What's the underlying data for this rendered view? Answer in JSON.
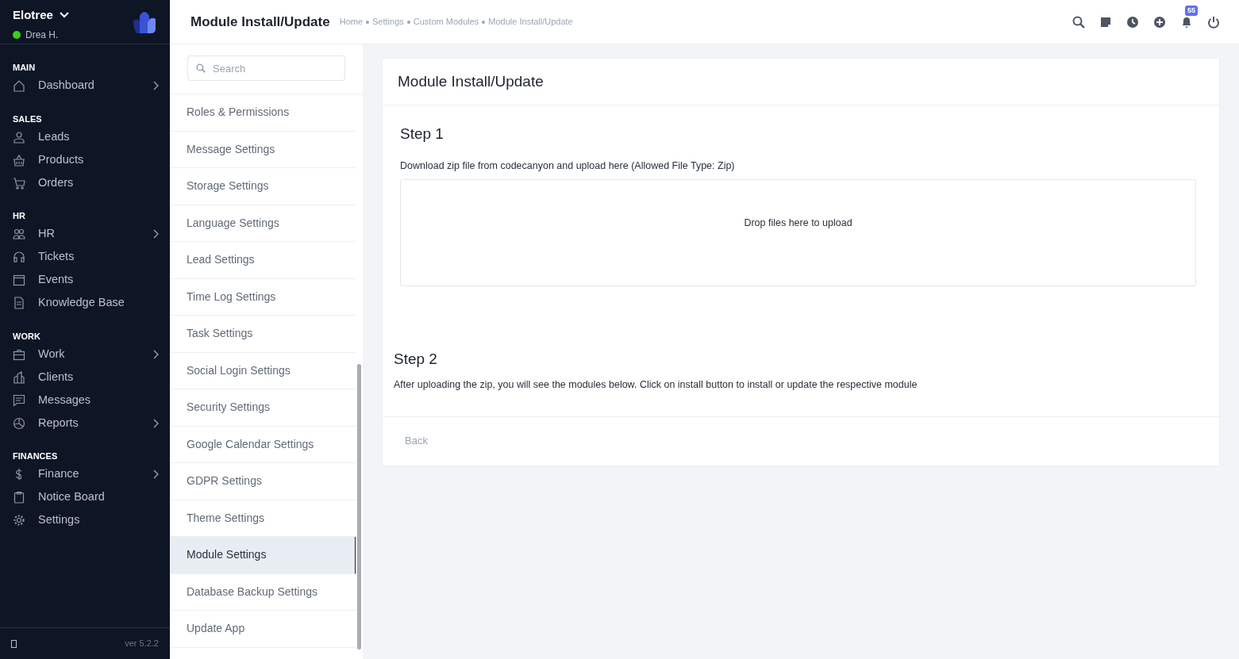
{
  "workspace": {
    "name": "Elotree",
    "user": "Drea H.",
    "online": true
  },
  "nav": [
    {
      "heading": "MAIN",
      "items": [
        {
          "label": "Dashboard",
          "expandable": true
        }
      ]
    },
    {
      "heading": "SALES",
      "items": [
        {
          "label": "Leads",
          "expandable": false
        },
        {
          "label": "Products",
          "expandable": false
        },
        {
          "label": "Orders",
          "expandable": false
        }
      ]
    },
    {
      "heading": "HR",
      "items": [
        {
          "label": "HR",
          "expandable": true
        },
        {
          "label": "Tickets",
          "expandable": false
        },
        {
          "label": "Events",
          "expandable": false
        },
        {
          "label": "Knowledge Base",
          "expandable": false
        }
      ]
    },
    {
      "heading": "WORK",
      "items": [
        {
          "label": "Work",
          "expandable": true
        },
        {
          "label": "Clients",
          "expandable": false
        },
        {
          "label": "Messages",
          "expandable": false
        },
        {
          "label": "Reports",
          "expandable": true
        }
      ]
    },
    {
      "heading": "FINANCES",
      "items": [
        {
          "label": "Finance",
          "expandable": true
        },
        {
          "label": "Notice Board",
          "expandable": false
        },
        {
          "label": "Settings",
          "expandable": false
        }
      ]
    }
  ],
  "version": "ver 5.2.2",
  "header": {
    "title": "Module Install/Update",
    "breadcrumb": [
      "Home",
      "Settings",
      "Custom Modules",
      "Module Install/Update"
    ],
    "notification_count": "55"
  },
  "settings_menu": {
    "search": {
      "placeholder": "Search"
    },
    "items": [
      {
        "label": "Roles & Permissions",
        "selected": false
      },
      {
        "label": "Message Settings",
        "selected": false
      },
      {
        "label": "Storage Settings",
        "selected": false
      },
      {
        "label": "Language Settings",
        "selected": false
      },
      {
        "label": "Lead Settings",
        "selected": false
      },
      {
        "label": "Time Log Settings",
        "selected": false
      },
      {
        "label": "Task Settings",
        "selected": false
      },
      {
        "label": "Social Login Settings",
        "selected": false
      },
      {
        "label": "Security Settings",
        "selected": false
      },
      {
        "label": "Google Calendar Settings",
        "selected": false
      },
      {
        "label": "GDPR Settings",
        "selected": false
      },
      {
        "label": "Theme Settings",
        "selected": false
      },
      {
        "label": "Module Settings",
        "selected": true
      },
      {
        "label": "Database Backup Settings",
        "selected": false
      },
      {
        "label": "Update App",
        "selected": false
      }
    ]
  },
  "card": {
    "title": "Module Install/Update",
    "step1": {
      "title": "Step 1",
      "text": "Download zip file from codecanyon and upload here (Allowed File Type: Zip)",
      "dropzone": "Drop files here to upload"
    },
    "step2": {
      "title": "Step 2",
      "text": "After uploading the zip, you will see the modules below. Click on install button to install or update the respective module"
    },
    "back_button": "Back"
  }
}
